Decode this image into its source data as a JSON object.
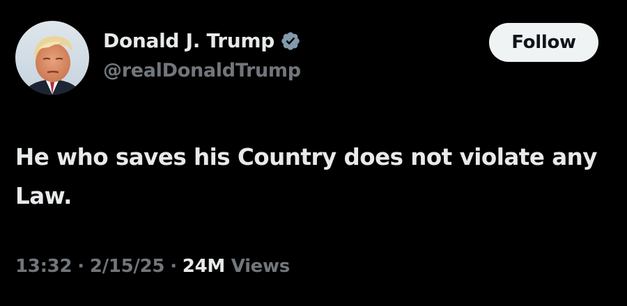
{
  "author": {
    "display_name": "Donald J. Trump",
    "handle": "@realDonaldTrump",
    "verified": true,
    "verified_color": "#829aab"
  },
  "actions": {
    "follow_label": "Follow"
  },
  "tweet": {
    "text": "He who saves his Country does not violate any Law."
  },
  "meta": {
    "time": "13:32",
    "date": "2/15/25",
    "views_count": "24M",
    "views_label": "Views",
    "separator": "·"
  },
  "icons": {
    "avatar": "profile-photo",
    "verified": "verified-badge-icon"
  },
  "colors": {
    "background": "#000000",
    "primary_text": "#e7e9ea",
    "secondary_text": "#71767b",
    "follow_button_bg": "#eff3f4",
    "follow_button_text": "#0f1419"
  }
}
